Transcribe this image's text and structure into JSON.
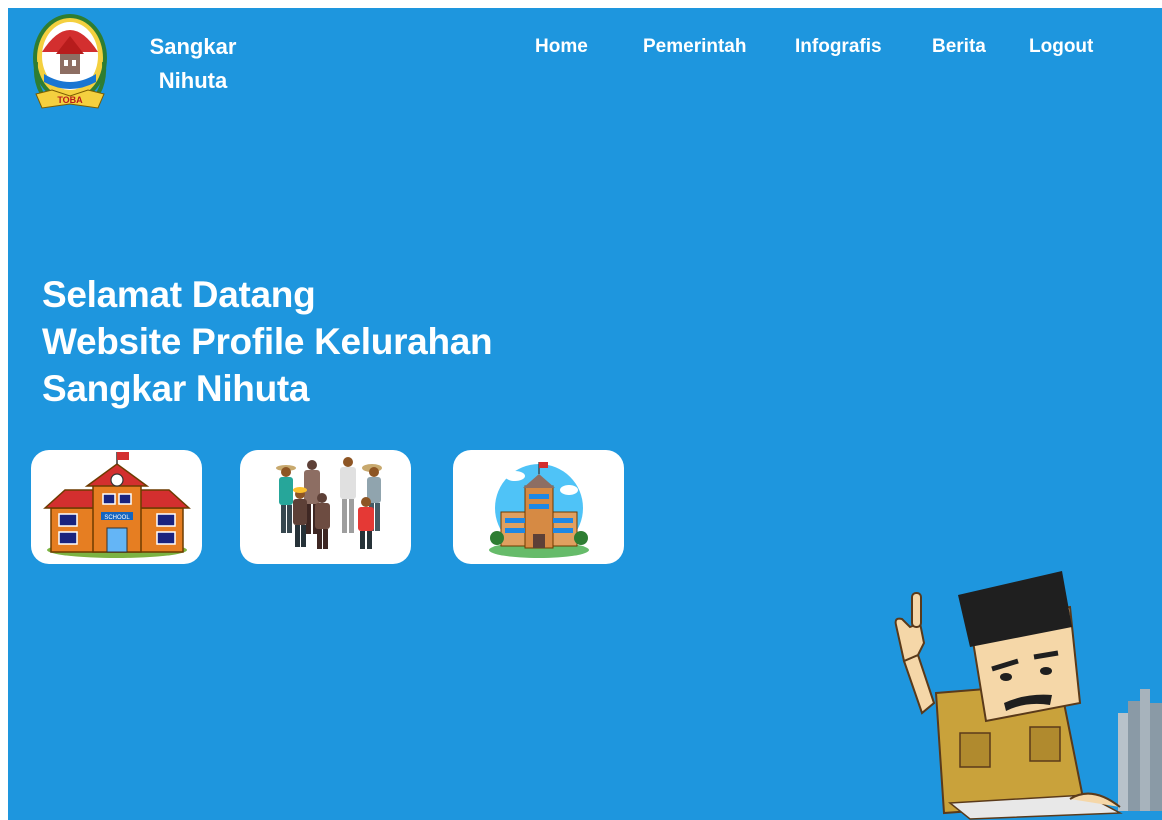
{
  "brand": {
    "line1": "Sangkar",
    "line2": "Nihuta",
    "logo_text": "TOBA",
    "logo_icon": "regency-emblem-icon"
  },
  "nav": {
    "items": [
      {
        "label": "Home"
      },
      {
        "label": "Pemerintah"
      },
      {
        "label": "Infografis"
      },
      {
        "label": "Berita"
      },
      {
        "label": "Logout"
      }
    ]
  },
  "hero": {
    "line1": "Selamat Datang",
    "line2": "Website Profile Kelurahan",
    "line3": "Sangkar Nihuta"
  },
  "cards": [
    {
      "icon": "school-building-icon",
      "sign_text": "SCHOOL"
    },
    {
      "icon": "villagers-group-icon"
    },
    {
      "icon": "office-building-icon"
    }
  ],
  "mascot": {
    "icon": "civil-servant-mascot-icon"
  },
  "colors": {
    "background": "#1e96de",
    "text": "#ffffff",
    "card": "#ffffff"
  }
}
